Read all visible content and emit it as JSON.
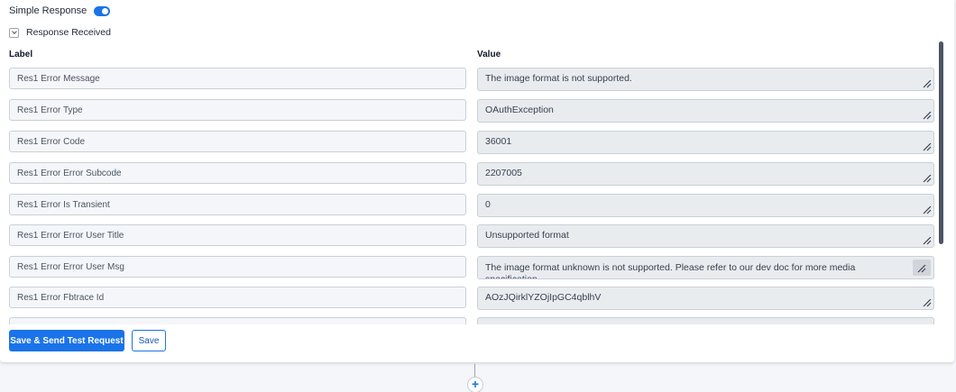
{
  "simple_response": {
    "label": "Simple Response",
    "enabled": true
  },
  "response_received": {
    "label": "Response Received",
    "expanded": true
  },
  "columns": {
    "label": "Label",
    "value": "Value"
  },
  "rows": [
    {
      "label": "Res1 Error Message",
      "value": "The image format is not supported."
    },
    {
      "label": "Res1 Error Type",
      "value": "OAuthException"
    },
    {
      "label": "Res1 Error Code",
      "value": "36001"
    },
    {
      "label": "Res1 Error Error Subcode",
      "value": "2207005"
    },
    {
      "label": "Res1 Error Is Transient",
      "value": "0"
    },
    {
      "label": "Res1 Error Error User Title",
      "value": "Unsupported format"
    },
    {
      "label": "Res1 Error Error User Msg",
      "value": "The image format unknown is not supported. Please refer to our dev doc for more media specification"
    },
    {
      "label": "Res1 Error Fbtrace Id",
      "value": "AOzJQirklYZOjIpGC4qblhV"
    },
    {
      "label": "",
      "value": ""
    }
  ],
  "buttons": {
    "save_send": "Save & Send Test Request",
    "save": "Save"
  },
  "add_step": {
    "symbol": "+"
  },
  "colors": {
    "accent": "#1a73e8",
    "field_bg": "#e9ecef",
    "label_bg": "#f4f6f9"
  }
}
